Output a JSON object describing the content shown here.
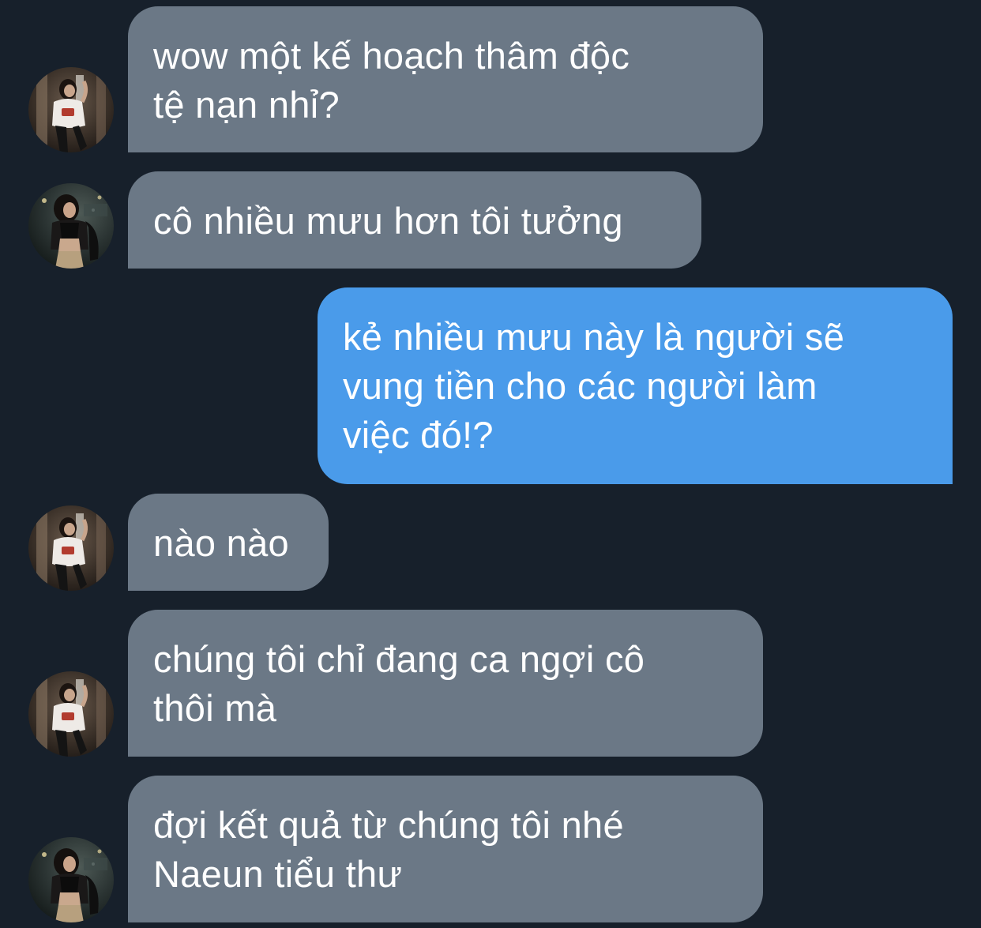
{
  "colors": {
    "background": "#17202b",
    "incoming_bubble": "#6b7886",
    "outgoing_bubble": "#4a9bea",
    "text": "#ffffff"
  },
  "messages": [
    {
      "direction": "incoming",
      "avatar": "avatar-white-shirt",
      "text": "wow một kế hoạch thâm độc\ntệ nạn nhỉ?"
    },
    {
      "direction": "incoming",
      "avatar": "avatar-black-top",
      "text": "cô nhiều mưu hơn tôi tưởng"
    },
    {
      "direction": "outgoing",
      "text": "kẻ nhiều mưu này là người sẽ\nvung tiền cho các người làm\nviệc đó!?"
    },
    {
      "direction": "incoming",
      "avatar": "avatar-white-shirt",
      "text": "nào nào"
    },
    {
      "direction": "incoming",
      "avatar": "avatar-white-shirt",
      "text": "chúng tôi chỉ đang ca ngợi cô\nthôi mà"
    },
    {
      "direction": "incoming",
      "avatar": "avatar-black-top",
      "text": "đợi kết quả từ chúng tôi nhé\nNaeun tiểu thư"
    }
  ]
}
